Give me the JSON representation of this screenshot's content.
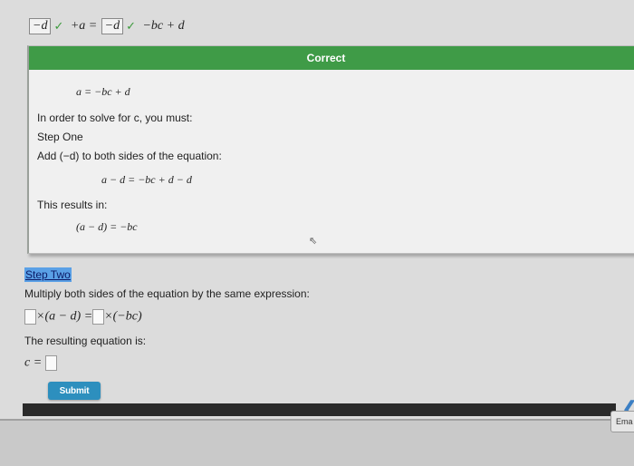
{
  "top_equation": {
    "answer1": "−d",
    "check_mark": "✓",
    "middle": "+a =",
    "answer2": "−d",
    "tail": "−bc + d"
  },
  "correct_panel": {
    "header": "Correct",
    "equation1": "a = −bc + d",
    "intro": "In order to solve for c, you must:",
    "step_one_label": "Step One",
    "step_one_instruction": "Add (−d) to both sides of the equation:",
    "equation2": "a − d = −bc + d − d",
    "result_label": "This results in:",
    "equation3": "(a − d) = −bc"
  },
  "step_two": {
    "label": "Step Two",
    "instruction": "Multiply both sides of the equation by the same expression:",
    "lhs": "×(a − d) =",
    "rhs": "×(−bc)",
    "result_label": "The resulting equation is:",
    "final_prefix": "c ="
  },
  "submit_label": "Submit",
  "chevron": "❮",
  "email_label": "Ema",
  "cursor_glyph": "⇖",
  "colors": {
    "correct_header": "#3f9b47",
    "submit": "#2d8fbe",
    "check": "#3c9a3c"
  }
}
